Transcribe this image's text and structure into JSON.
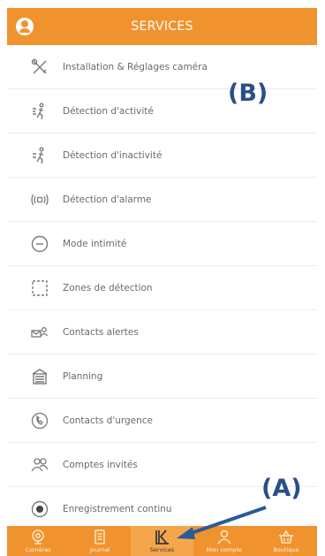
{
  "header": {
    "title": "SERVICES",
    "avatar_icon": "user-avatar-icon"
  },
  "menu": [
    {
      "id": "installation",
      "icon": "tools-icon",
      "label": "Installation & Réglages caméra"
    },
    {
      "id": "detection-activite",
      "icon": "motion-icon",
      "label": "Détection d'activité"
    },
    {
      "id": "detection-inactivite",
      "icon": "inactivity-icon",
      "label": "Détection d'inactivité"
    },
    {
      "id": "detection-alarme",
      "icon": "alarm-waves-icon",
      "label": "Détection d'alarme"
    },
    {
      "id": "mode-intimite",
      "icon": "minus-circle-icon",
      "label": "Mode intimité"
    },
    {
      "id": "zones-detection",
      "icon": "dashed-square-icon",
      "label": "Zones de détection"
    },
    {
      "id": "contacts-alertes",
      "icon": "contacts-alert-icon",
      "label": "Contacts alertes"
    },
    {
      "id": "planning",
      "icon": "planning-icon",
      "label": "Planning"
    },
    {
      "id": "contacts-urgence",
      "icon": "phone-circle-icon",
      "label": "Contacts d'urgence"
    },
    {
      "id": "comptes-invites",
      "icon": "guests-icon",
      "label": "Comptes invités"
    },
    {
      "id": "enregistrement-continu",
      "icon": "record-icon",
      "label": "Enregistrement continu"
    }
  ],
  "annotations": {
    "a": "(A)",
    "b": "(B)"
  },
  "tabbar": {
    "active": "services",
    "tabs": [
      {
        "id": "cameras",
        "icon": "camera-icon",
        "label": "Caméras"
      },
      {
        "id": "journal",
        "icon": "journal-icon",
        "label": "Journal"
      },
      {
        "id": "services",
        "icon": "services-logo-icon",
        "label": "Services"
      },
      {
        "id": "mon-compte",
        "icon": "account-icon",
        "label": "Mon compte"
      },
      {
        "id": "boutique",
        "icon": "basket-icon",
        "label": "Boutique"
      }
    ]
  },
  "colors": {
    "accent": "#f0932f",
    "annotation": "#2a4f88",
    "text": "#6a6a6a"
  }
}
